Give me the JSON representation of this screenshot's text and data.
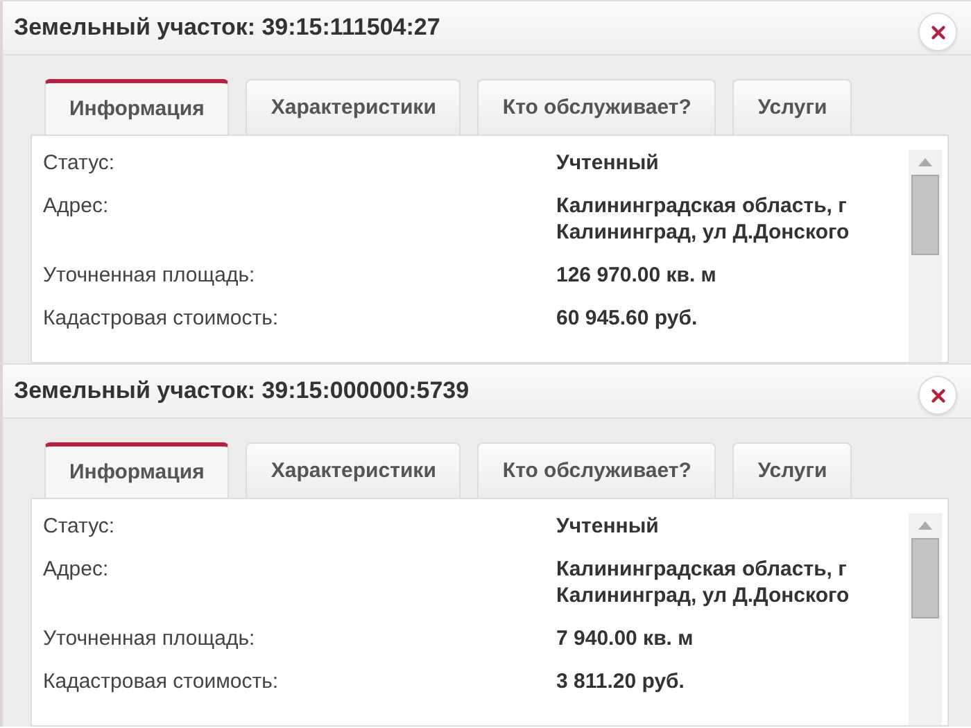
{
  "panels": [
    {
      "title": "Земельный участок: 39:15:111504:27",
      "tabs": [
        {
          "label": "Информация",
          "selected": true
        },
        {
          "label": "Характеристики",
          "selected": false
        },
        {
          "label": "Кто обслуживает?",
          "selected": false
        },
        {
          "label": "Услуги",
          "selected": false
        }
      ],
      "rows": [
        {
          "label": "Статус:",
          "value": "Учтенный"
        },
        {
          "label": "Адрес:",
          "value": "Калининградская область, г Калининград, ул Д.Донского"
        },
        {
          "label": "Уточненная площадь:",
          "value": "126 970.00 кв. м"
        },
        {
          "label": "Кадастровая стоимость:",
          "value": "60 945.60 руб."
        }
      ]
    },
    {
      "title": "Земельный участок: 39:15:000000:5739",
      "tabs": [
        {
          "label": "Информация",
          "selected": true
        },
        {
          "label": "Характеристики",
          "selected": false
        },
        {
          "label": "Кто обслуживает?",
          "selected": false
        },
        {
          "label": "Услуги",
          "selected": false
        }
      ],
      "rows": [
        {
          "label": "Статус:",
          "value": "Учтенный"
        },
        {
          "label": "Адрес:",
          "value": "Калининградская область, г Калининград, ул Д.Донского"
        },
        {
          "label": "Уточненная площадь:",
          "value": "7 940.00 кв. м"
        },
        {
          "label": "Кадастровая стоимость:",
          "value": "3 811.20 руб."
        }
      ]
    }
  ]
}
